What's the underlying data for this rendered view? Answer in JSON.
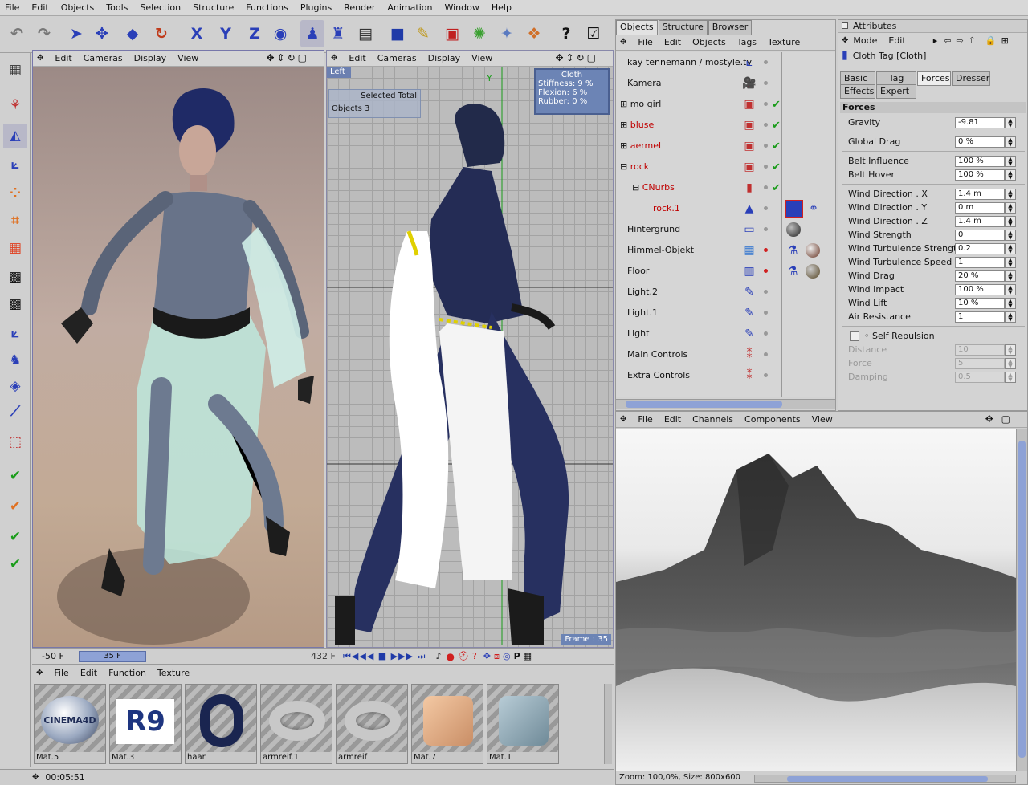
{
  "menubar": [
    "File",
    "Edit",
    "Objects",
    "Tools",
    "Selection",
    "Structure",
    "Functions",
    "Plugins",
    "Render",
    "Animation",
    "Window",
    "Help"
  ],
  "perspective_view": {
    "menu": [
      "Edit",
      "Cameras",
      "Display",
      "View"
    ]
  },
  "front_view": {
    "menu": [
      "Edit",
      "Cameras",
      "Display",
      "View"
    ],
    "view_label": "Left",
    "y_axis": "Y",
    "selected_total": "Selected Total",
    "objects_label": "Objects",
    "objects_value": "3",
    "hud_title": "Cloth",
    "hud": [
      {
        "k": "Stiffness:",
        "v": "9 %"
      },
      {
        "k": "Flexion:",
        "v": "6 %"
      },
      {
        "k": "Rubber:",
        "v": "0 %"
      }
    ],
    "frame": "Frame : 35"
  },
  "timeline": {
    "start": "-50 F",
    "current": "35 F",
    "end": "432 F"
  },
  "materials": {
    "menu": [
      "File",
      "Edit",
      "Function",
      "Texture"
    ],
    "items": [
      {
        "name": "Mat.5",
        "logo": "CINEMA4D"
      },
      {
        "name": "Mat.3",
        "logo": "R9"
      },
      {
        "name": "haar",
        "logo": ""
      },
      {
        "name": "armreif.1",
        "logo": ""
      },
      {
        "name": "armreif",
        "logo": ""
      },
      {
        "name": "Mat.7",
        "logo": ""
      },
      {
        "name": "Mat.1",
        "logo": ""
      }
    ]
  },
  "status": {
    "time": "00:05:51"
  },
  "object_manager": {
    "tabs": [
      "Objects",
      "Structure",
      "Browser"
    ],
    "menu": [
      "File",
      "Edit",
      "Objects",
      "Tags",
      "Texture"
    ],
    "rows": [
      {
        "label": "kay tennemann / mostyle.tv",
        "red": false
      },
      {
        "label": "Kamera",
        "red": false
      },
      {
        "label": "mo girl",
        "red": false
      },
      {
        "label": "bluse",
        "red": true
      },
      {
        "label": "aermel",
        "red": true
      },
      {
        "label": "rock",
        "red": true
      },
      {
        "label": "CNurbs",
        "red": true
      },
      {
        "label": "rock.1",
        "red": true
      },
      {
        "label": "Hintergrund",
        "red": false
      },
      {
        "label": "Himmel-Objekt",
        "red": false
      },
      {
        "label": "Floor",
        "red": false
      },
      {
        "label": "Light.2",
        "red": false
      },
      {
        "label": "Light.1",
        "red": false
      },
      {
        "label": "Light",
        "red": false
      },
      {
        "label": "Main Controls",
        "red": false
      },
      {
        "label": "Extra Controls",
        "red": false
      }
    ]
  },
  "attributes": {
    "title": "Attributes",
    "menu": [
      "Mode",
      "Edit"
    ],
    "tag_name": "Cloth Tag [Cloth]",
    "tabs_row1": [
      "Basic",
      "Tag",
      "Forces",
      "Dresser"
    ],
    "tabs_row2": [
      "Effects",
      "Expert"
    ],
    "section": "Forces",
    "fields": [
      {
        "name": "Gravity",
        "value": "-9.81"
      },
      {
        "name": "Global Drag",
        "value": "0 %"
      },
      {
        "name": "Belt Influence",
        "value": "100 %"
      },
      {
        "name": "Belt Hover",
        "value": "100 %"
      },
      {
        "name": "Wind Direction . X",
        "value": "1.4 m"
      },
      {
        "name": "Wind Direction . Y",
        "value": "0 m"
      },
      {
        "name": "Wind Direction . Z",
        "value": "1.4 m"
      },
      {
        "name": "Wind Strength",
        "value": "0"
      },
      {
        "name": "Wind Turbulence Strength",
        "value": "0.2"
      },
      {
        "name": "Wind Turbulence Speed",
        "value": "1"
      },
      {
        "name": "Wind Drag",
        "value": "20 %"
      },
      {
        "name": "Wind Impact",
        "value": "100 %"
      },
      {
        "name": "Wind Lift",
        "value": "10 %"
      },
      {
        "name": "Air Resistance",
        "value": "1"
      }
    ],
    "self_repulsion": "Self Repulsion",
    "disabled_fields": [
      {
        "name": "Distance",
        "value": "10"
      },
      {
        "name": "Force",
        "value": "5"
      },
      {
        "name": "Damping",
        "value": "0.5"
      }
    ]
  },
  "render_view": {
    "menu": [
      "File",
      "Edit",
      "Channels",
      "Components",
      "View"
    ],
    "status": "Zoom: 100,0%, Size: 800x600"
  }
}
